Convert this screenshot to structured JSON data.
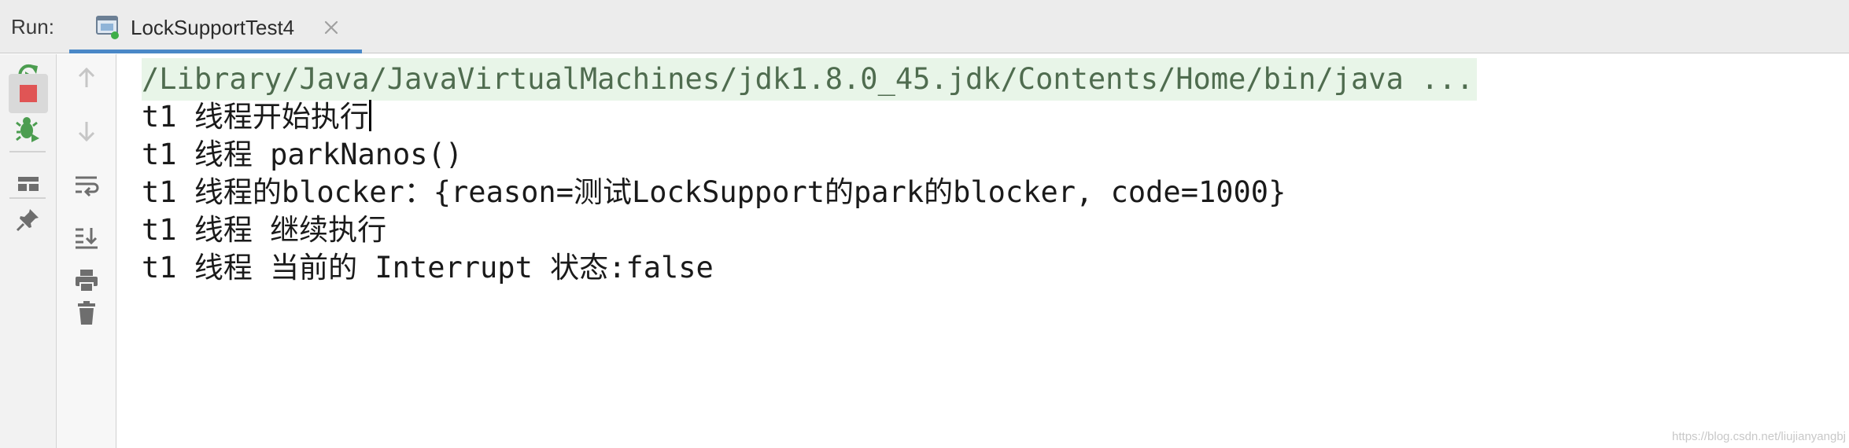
{
  "header": {
    "run_label": "Run:",
    "tab": {
      "title": "LockSupportTest4",
      "icon": "run-config-icon",
      "close_icon": "close-icon"
    }
  },
  "toolbar_left": [
    {
      "name": "rerun-icon",
      "color": "#4c9d50"
    },
    {
      "name": "stop-icon",
      "color": "#e05555"
    },
    {
      "name": "debug-rerun-icon",
      "color": "#4c9d50"
    },
    {
      "name": "layout-icon",
      "color": "#6e6e6e"
    },
    {
      "name": "pin-icon",
      "color": "#6e6e6e"
    }
  ],
  "toolbar_right": [
    {
      "name": "arrow-up-icon"
    },
    {
      "name": "arrow-down-icon"
    },
    {
      "name": "soft-wrap-icon"
    },
    {
      "name": "scroll-to-end-icon"
    },
    {
      "name": "print-icon"
    },
    {
      "name": "trash-icon"
    }
  ],
  "console": {
    "command": "/Library/Java/JavaVirtualMachines/jdk1.8.0_45.jdk/Contents/Home/bin/java ...",
    "lines": [
      "t1 线程开始执行",
      "t1 线程 parkNanos()",
      "t1 线程的blocker：{reason=测试LockSupport的park的blocker, code=1000}",
      "t1 线程 继续执行",
      "t1 线程 当前的 Interrupt 状态:false"
    ]
  },
  "watermark": "https://blog.csdn.net/liujianyangbj",
  "colors": {
    "accent": "#4a88c7",
    "command_bg": "#e8f5e8",
    "command_text": "#4f6c4f"
  }
}
